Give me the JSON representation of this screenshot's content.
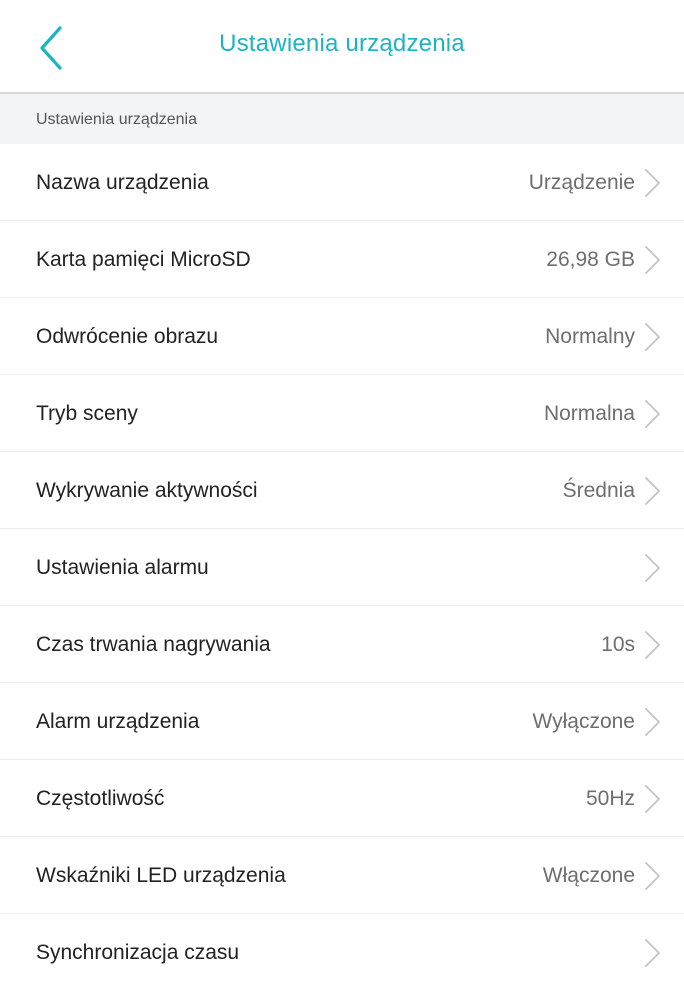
{
  "header": {
    "title": "Ustawienia urządzenia",
    "back_icon": "chevron-left-icon",
    "accent_color": "#1eb3c2"
  },
  "section": {
    "title": "Ustawienia urządzenia"
  },
  "rows": [
    {
      "label": "Nazwa urządzenia",
      "value": "Urządzenie"
    },
    {
      "label": "Karta pamięci MicroSD",
      "value": "26,98 GB"
    },
    {
      "label": "Odwrócenie obrazu",
      "value": "Normalny"
    },
    {
      "label": "Tryb sceny",
      "value": "Normalna"
    },
    {
      "label": "Wykrywanie aktywności",
      "value": "Średnia"
    },
    {
      "label": "Ustawienia alarmu",
      "value": ""
    },
    {
      "label": "Czas trwania nagrywania",
      "value": "10s"
    },
    {
      "label": "Alarm urządzenia",
      "value": "Wyłączone"
    },
    {
      "label": "Częstotliwość",
      "value": "50Hz"
    },
    {
      "label": "Wskaźniki LED urządzenia",
      "value": "Włączone"
    },
    {
      "label": "Synchronizacja czasu",
      "value": ""
    }
  ],
  "row_icon": "chevron-right-icon"
}
